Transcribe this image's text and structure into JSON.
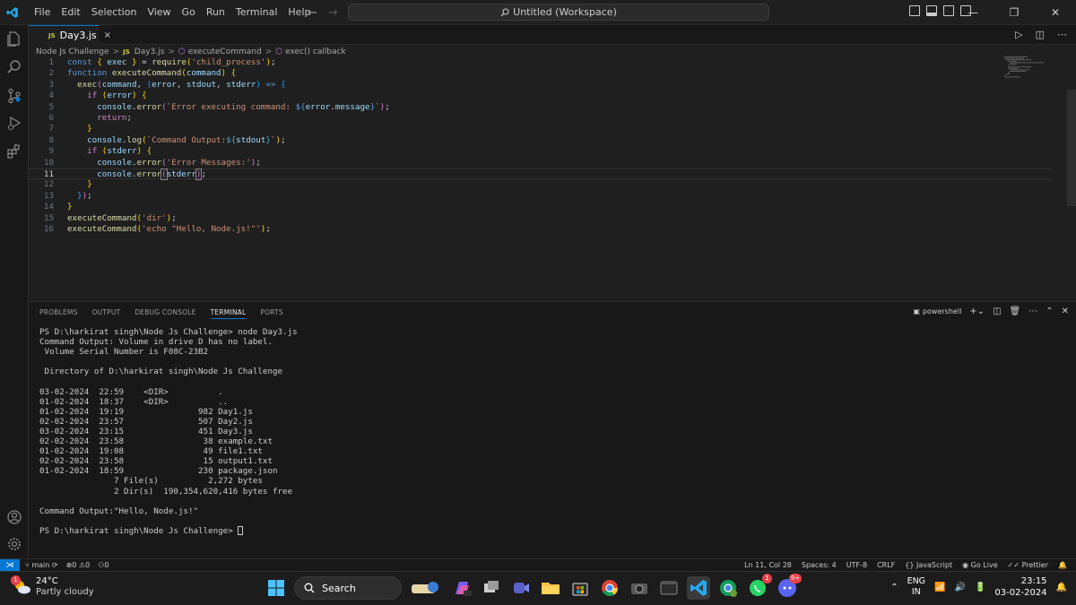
{
  "menu": [
    "File",
    "Edit",
    "Selection",
    "View",
    "Go",
    "Run",
    "Terminal",
    "Help"
  ],
  "command_center": "Untitled (Workspace)",
  "tab": {
    "badge": "JS",
    "label": "Day3.js",
    "close": "×"
  },
  "breadcrumb": {
    "folder": "Node Js Challenge",
    "file_badge": "JS",
    "file": "Day3.js",
    "func": "executeCommand",
    "callback": "exec() callback",
    "sep": ">"
  },
  "code_lines": [
    {
      "n": "1"
    },
    {
      "n": "2"
    },
    {
      "n": "3"
    },
    {
      "n": "4"
    },
    {
      "n": "5"
    },
    {
      "n": "6"
    },
    {
      "n": "7"
    },
    {
      "n": "8"
    },
    {
      "n": "9"
    },
    {
      "n": "10"
    },
    {
      "n": "11"
    },
    {
      "n": "12"
    },
    {
      "n": "13"
    },
    {
      "n": "14"
    },
    {
      "n": "15"
    },
    {
      "n": "16"
    }
  ],
  "panel": {
    "tabs": [
      "PROBLEMS",
      "OUTPUT",
      "DEBUG CONSOLE",
      "TERMINAL",
      "PORTS"
    ],
    "active_tab": "TERMINAL",
    "shell": "powershell"
  },
  "terminal_lines": [
    "PS D:\\harkirat singh\\Node Js Challenge> node Day3.js",
    "Command Output: Volume in drive D has no label.",
    " Volume Serial Number is F08C-23B2",
    "",
    " Directory of D:\\harkirat singh\\Node Js Challenge",
    "",
    "03-02-2024  22:59    <DIR>          .",
    "01-02-2024  18:37    <DIR>          ..",
    "01-02-2024  19:19               982 Day1.js",
    "02-02-2024  23:57               507 Day2.js",
    "03-02-2024  23:15               451 Day3.js",
    "02-02-2024  23:58                38 example.txt",
    "01-02-2024  19:08                49 file1.txt",
    "02-02-2024  23:58                15 output1.txt",
    "01-02-2024  18:59               230 package.json",
    "               7 File(s)          2,272 bytes",
    "               2 Dir(s)  190,354,620,416 bytes free",
    "",
    "Command Output:\"Hello, Node.js!\"",
    "",
    "PS D:\\harkirat singh\\Node Js Challenge> "
  ],
  "statusbar": {
    "branch": "main",
    "errors": "0",
    "warnings": "0",
    "ports": "0",
    "position": "Ln 11, Col 28",
    "spaces": "Spaces: 4",
    "encoding": "UTF-8",
    "eol": "CRLF",
    "language": "JavaScript",
    "live": "Go Live",
    "prettier": "Prettier"
  },
  "taskbar": {
    "weather_temp": "24°C",
    "weather_desc": "Partly cloudy",
    "weather_badge": "1",
    "search_label": "Search",
    "whatsapp_badge": "1",
    "discord_badge": "9+",
    "lang_top": "ENG",
    "lang_bottom": "IN",
    "time": "23:15",
    "date": "03-02-2024"
  },
  "colors": {
    "accent": "#0078d4",
    "keyword": "#569cd6",
    "string": "#ce9178",
    "function": "#dcdcaa",
    "variable": "#9cdcfe"
  }
}
